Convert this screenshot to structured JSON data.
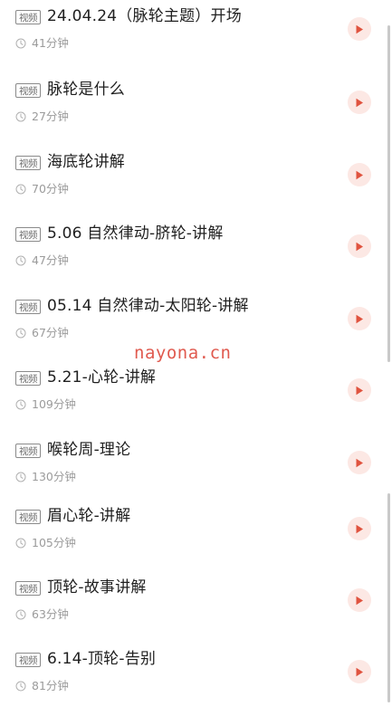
{
  "course_list": {
    "tag_label": "视频",
    "items": [
      {
        "title": "24.04.24（脉轮主题）开场",
        "duration": "41分钟"
      },
      {
        "title": "脉轮是什么",
        "duration": "27分钟"
      },
      {
        "title": "海底轮讲解",
        "duration": "70分钟"
      },
      {
        "title": "5.06 自然律动-脐轮-讲解",
        "duration": "47分钟"
      },
      {
        "title": "05.14 自然律动-太阳轮-讲解",
        "duration": "67分钟"
      },
      {
        "title": "5.21-心轮-讲解",
        "duration": "109分钟"
      },
      {
        "title": "喉轮周-理论",
        "duration": "130分钟"
      },
      {
        "title": "眉心轮-讲解",
        "duration": "105分钟"
      },
      {
        "title": "顶轮-故事讲解",
        "duration": "63分钟"
      },
      {
        "title": "6.14-顶轮-告别",
        "duration": "81分钟"
      }
    ]
  },
  "watermark": "nayona.cn",
  "colors": {
    "play_bg": "#fce8e4",
    "play_icon": "#e0533f",
    "title": "#1f1f1f",
    "meta": "#9b9b9b",
    "watermark": "#e05a4f"
  },
  "icons": {
    "tag": "video-tag",
    "clock": "clock-icon",
    "play": "play-icon"
  }
}
